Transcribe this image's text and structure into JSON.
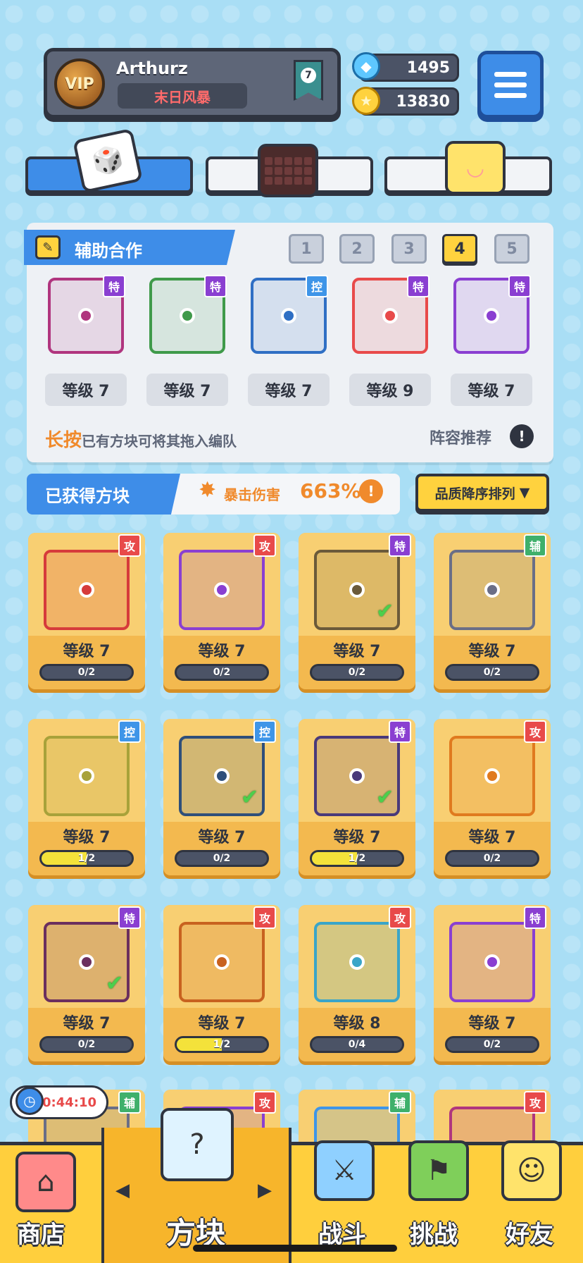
{
  "profile": {
    "vip_label": "VIP",
    "username": "Arthurz",
    "title": "末日风暴",
    "rank": "7"
  },
  "currency": {
    "gems": "1495",
    "coins": "13830"
  },
  "assist": {
    "title": "辅助合作",
    "lineup_tabs": [
      "1",
      "2",
      "3",
      "4",
      "5"
    ],
    "active_tab": "4",
    "slots": [
      {
        "type": "特",
        "level": "等级 7",
        "color": "#b0357e"
      },
      {
        "type": "特",
        "level": "等级 7",
        "color": "#3f9a4a"
      },
      {
        "type": "控",
        "level": "等级 7",
        "color": "#2f6fc4"
      },
      {
        "type": "特",
        "level": "等级 9",
        "color": "#e84a4a"
      },
      {
        "type": "特",
        "level": "等级 7",
        "color": "#8a3fd1"
      }
    ],
    "hint_highlight": "长按",
    "hint_text": "已有方块可将其拖入编队",
    "recommend_label": "阵容推荐",
    "recommend_icon": "!"
  },
  "obtained": {
    "title": "已获得方块",
    "crit_label": "暴击伤害",
    "crit_value": "663%",
    "crit_icon": "!",
    "sort_label": "品质降序排列",
    "sort_arrow": "▼"
  },
  "cards": [
    {
      "type": "攻",
      "level": "等级 7",
      "progress": "0/2",
      "fill": 0,
      "color": "#d63b3b",
      "checked": false
    },
    {
      "type": "攻",
      "level": "等级 7",
      "progress": "0/2",
      "fill": 0,
      "color": "#8a3fd1",
      "checked": false
    },
    {
      "type": "特",
      "level": "等级 7",
      "progress": "0/2",
      "fill": 0,
      "color": "#6b5a3a",
      "checked": true
    },
    {
      "type": "辅",
      "level": "等级 7",
      "progress": "0/2",
      "fill": 0,
      "color": "#6a6e86",
      "checked": false
    },
    {
      "type": "控",
      "level": "等级 7",
      "progress": "1/2",
      "fill": 0.5,
      "color": "#a8a23a",
      "checked": false
    },
    {
      "type": "控",
      "level": "等级 7",
      "progress": "0/2",
      "fill": 0,
      "color": "#2f4f7a",
      "checked": true
    },
    {
      "type": "特",
      "level": "等级 7",
      "progress": "1/2",
      "fill": 0.5,
      "color": "#4a3a7a",
      "checked": true
    },
    {
      "type": "攻",
      "level": "等级 7",
      "progress": "0/2",
      "fill": 0,
      "color": "#e07a1f",
      "checked": false
    },
    {
      "type": "特",
      "level": "等级 7",
      "progress": "0/2",
      "fill": 0,
      "color": "#6b2f5e",
      "checked": true
    },
    {
      "type": "攻",
      "level": "等级 7",
      "progress": "1/2",
      "fill": 0.5,
      "color": "#c8621f",
      "checked": false
    },
    {
      "type": "攻",
      "level": "等级 8",
      "progress": "0/4",
      "fill": 0,
      "color": "#3aa5c8",
      "checked": false
    },
    {
      "type": "特",
      "level": "等级 7",
      "progress": "0/2",
      "fill": 0,
      "color": "#8a3fd1",
      "checked": false
    }
  ],
  "partial_cards": [
    {
      "type": "辅",
      "color": "#6a6e86"
    },
    {
      "type": "攻",
      "color": "#8a3fd1"
    },
    {
      "type": "辅",
      "color": "#3e95e8"
    },
    {
      "type": "攻",
      "color": "#b0357e"
    }
  ],
  "timer": "00:44:10",
  "nav": {
    "shop": "商店",
    "blocks": "方块",
    "battle": "战斗",
    "challenge": "挑战",
    "friends": "好友",
    "left_arrow": "◀",
    "right_arrow": "▶"
  },
  "icons": {
    "gem": "gem-icon",
    "coin": "coin-icon",
    "menu": "hamburger-icon",
    "pencil": "pencil-icon",
    "crit": "burst-icon",
    "clock": "clock-icon"
  }
}
